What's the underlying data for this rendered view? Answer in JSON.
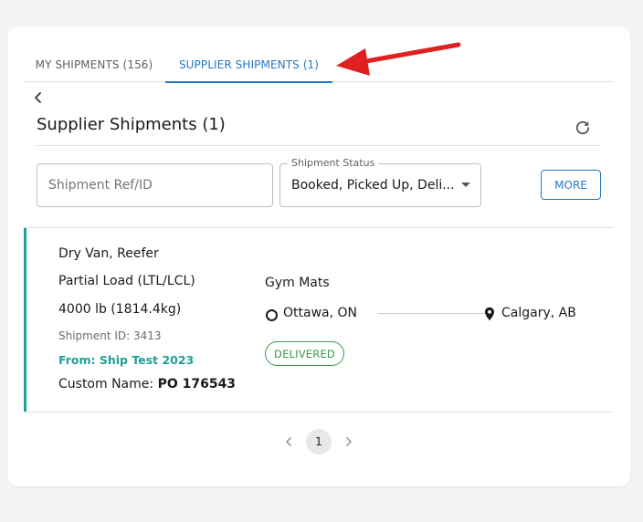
{
  "tabs": [
    {
      "label": "MY SHIPMENTS (156)"
    },
    {
      "label": "SUPPLIER SHIPMENTS (1)"
    }
  ],
  "page": {
    "title": "Supplier Shipments (1)"
  },
  "filters": {
    "search_placeholder": "Shipment Ref/ID",
    "status_label": "Shipment Status",
    "status_value": "Booked, Picked Up, Deli...",
    "more_label": "MORE"
  },
  "shipment": {
    "equipment": "Dry Van, Reefer",
    "load_type": "Partial Load (LTL/LCL)",
    "weight": "4000 lb (1814.4kg)",
    "shipment_id": "Shipment ID: 3413",
    "from": "From: Ship Test 2023",
    "custom_name_label": "Custom Name:",
    "custom_name_value": "PO 176543",
    "commodity": "Gym Mats",
    "origin": "Ottawa, ON",
    "destination": "Calgary, AB",
    "status": "DELIVERED"
  },
  "pagination": {
    "current_page": "1"
  },
  "colors": {
    "accent": "#1f9f9a",
    "tab_active": "#2479c4",
    "status_delivered": "#3a9a48",
    "annotation_arrow": "#e02020"
  },
  "icons": [
    "chevron-left-icon",
    "refresh-icon",
    "caret-down-icon",
    "origin-circle-icon",
    "location-pin-icon",
    "annotation-arrow-icon",
    "chevron-right-icon"
  ]
}
